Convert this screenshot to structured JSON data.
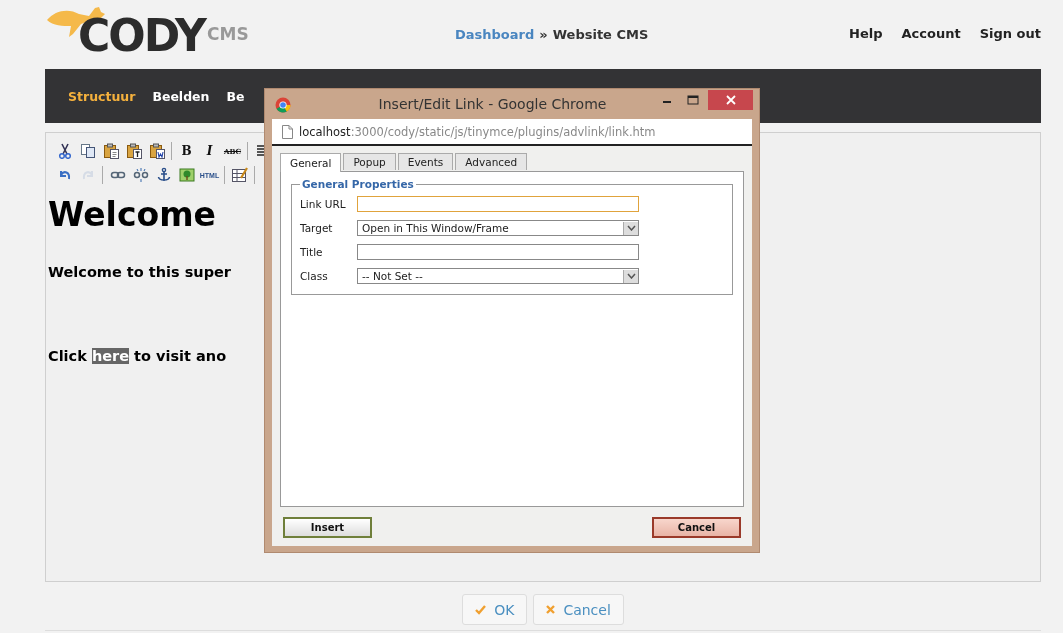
{
  "logo": {
    "name": "CODY",
    "suffix": "CMS"
  },
  "breadcrumb": {
    "items": [
      {
        "label": "Dashboard",
        "link": true
      },
      {
        "label": "Website CMS",
        "link": false
      }
    ],
    "separator": "»"
  },
  "user_menu": [
    "Help",
    "Account",
    "Sign out"
  ],
  "nav": [
    {
      "label": "Structuur",
      "selected": true
    },
    {
      "label": "Beelden",
      "selected": false
    },
    {
      "label": "Be",
      "selected": false
    }
  ],
  "editor": {
    "toolbar": [
      [
        {
          "kind": "cut",
          "disabled": false
        },
        {
          "kind": "copy",
          "disabled": false
        },
        {
          "kind": "paste",
          "disabled": false
        },
        {
          "kind": "paste_text",
          "disabled": false
        },
        {
          "kind": "paste_word",
          "disabled": false
        },
        {
          "kind": "sep"
        },
        {
          "kind": "bold",
          "text": "B",
          "disabled": false
        },
        {
          "kind": "italic",
          "text": "I",
          "disabled": false
        },
        {
          "kind": "strike",
          "text": "ABC",
          "disabled": false
        },
        {
          "kind": "sep"
        },
        {
          "kind": "align",
          "disabled": false
        }
      ],
      [
        {
          "kind": "undo",
          "disabled": false
        },
        {
          "kind": "redo",
          "disabled": true
        },
        {
          "kind": "sep"
        },
        {
          "kind": "link",
          "disabled": false
        },
        {
          "kind": "unlink",
          "disabled": false
        },
        {
          "kind": "anchor",
          "disabled": false
        },
        {
          "kind": "image",
          "disabled": false
        },
        {
          "kind": "html",
          "text": "HTML",
          "disabled": false
        },
        {
          "kind": "sep"
        },
        {
          "kind": "table",
          "disabled": false
        },
        {
          "kind": "sep"
        }
      ]
    ],
    "heading": "Welcome",
    "paragraph": "Welcome to this super",
    "link_line": {
      "before": "Click ",
      "link": "here",
      "after": " to visit ano",
      "link_selected": true
    }
  },
  "actions": [
    {
      "kind": "ok",
      "label": "OK"
    },
    {
      "kind": "cancel",
      "label": "Cancel"
    }
  ],
  "dialog": {
    "title": "Insert/Edit Link - Google Chrome",
    "url_host": "localhost",
    "url_path": ":3000/cody/static/js/tinymce/plugins/advlink/link.htm",
    "tabs": [
      {
        "label": "General",
        "selected": true
      },
      {
        "label": "Popup",
        "selected": false
      },
      {
        "label": "Events",
        "selected": false
      },
      {
        "label": "Advanced",
        "selected": false
      }
    ],
    "legend": "General Properties",
    "fields": [
      {
        "label": "Link URL",
        "kind": "text",
        "focused": true
      },
      {
        "label": "Target",
        "kind": "select",
        "value": "Open in This Window/Frame",
        "focused": false
      },
      {
        "label": "Title",
        "kind": "text",
        "focused": false
      },
      {
        "label": "Class",
        "kind": "select",
        "value": "-- Not Set --",
        "focused": false
      }
    ],
    "buttons": [
      {
        "kind": "insert",
        "label": "Insert"
      },
      {
        "kind": "cancel",
        "label": "Cancel"
      }
    ]
  }
}
